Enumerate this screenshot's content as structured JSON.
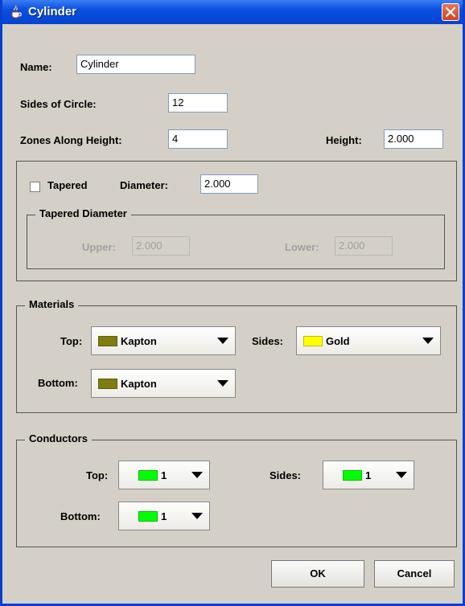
{
  "window": {
    "title": "Cylinder",
    "app_icon": "java-cup-icon",
    "close_icon": "close-x-icon"
  },
  "name": {
    "label": "Name:",
    "value": "Cylinder"
  },
  "sides_of_circle": {
    "label": "Sides of Circle:",
    "value": "12"
  },
  "zones_along_height": {
    "label": "Zones Along Height:",
    "value": "4"
  },
  "height": {
    "label": "Height:",
    "value": "2.000"
  },
  "taper": {
    "checkbox_label": "Tapered",
    "checked": false,
    "diameter_label": "Diameter:",
    "diameter_value": "2.000",
    "group_title": "Tapered Diameter",
    "upper_label": "Upper:",
    "upper_value": "2.000",
    "lower_label": "Lower:",
    "lower_value": "2.000"
  },
  "materials": {
    "title": "Materials",
    "top": {
      "label": "Top:",
      "value": "Kapton",
      "color": "#807c10"
    },
    "sides": {
      "label": "Sides:",
      "value": "Gold",
      "color": "#ffff00"
    },
    "bottom": {
      "label": "Bottom:",
      "value": "Kapton",
      "color": "#807c10"
    }
  },
  "conductors": {
    "title": "Conductors",
    "top": {
      "label": "Top:",
      "value": "1",
      "color": "#00ff00"
    },
    "sides": {
      "label": "Sides:",
      "value": "1",
      "color": "#00ff00"
    },
    "bottom": {
      "label": "Bottom:",
      "value": "1",
      "color": "#00ff00"
    }
  },
  "buttons": {
    "ok": "OK",
    "cancel": "Cancel"
  }
}
